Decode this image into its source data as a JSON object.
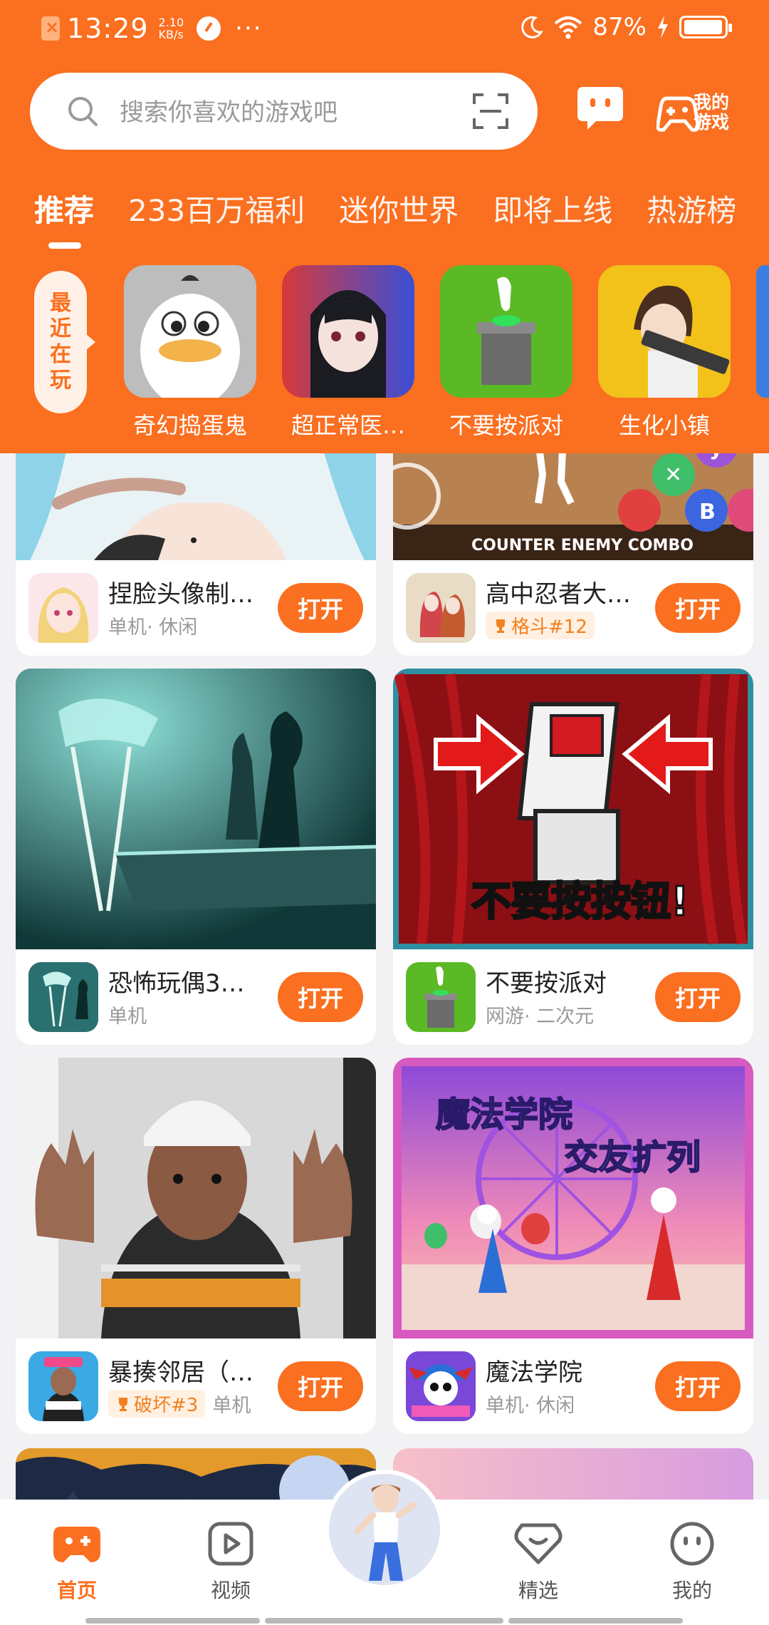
{
  "status_bar": {
    "time": "13:29",
    "speed_value": "2.10",
    "speed_unit": "KB/s",
    "more": "···",
    "battery": "87%"
  },
  "search": {
    "placeholder": "搜索你喜欢的游戏吧"
  },
  "header": {
    "my_games_label": "我的游戏"
  },
  "tabs": [
    {
      "label": "推荐",
      "active": true
    },
    {
      "label": "233百万福利",
      "active": false
    },
    {
      "label": "迷你世界",
      "active": false
    },
    {
      "label": "即将上线",
      "active": false
    },
    {
      "label": "热游榜",
      "active": false
    }
  ],
  "recent": {
    "tag_chars": [
      "最",
      "近",
      "在",
      "玩"
    ],
    "items": [
      {
        "name": "奇幻捣蛋鬼"
      },
      {
        "name": "超正常医…"
      },
      {
        "name": "不要按派对"
      },
      {
        "name": "生化小镇"
      }
    ]
  },
  "feed": {
    "open_label": "打开",
    "cards": [
      {
        "title": "捏脸头像制…",
        "tags": "单机· 休闲",
        "rank": ""
      },
      {
        "title": "高中忍者大…",
        "tags": "",
        "rank": "格斗#12",
        "image_caption": "COUNTER ENEMY COMBO"
      },
      {
        "title": "恐怖玩偶3…",
        "tags": "单机",
        "rank": ""
      },
      {
        "title": "不要按派对",
        "tags": "网游· 二次元",
        "rank": "",
        "image_caption": "不要按按钮!"
      },
      {
        "title": "暴揍邻居（…",
        "tags": "单机",
        "rank": "破坏#3"
      },
      {
        "title": "魔法学院",
        "tags": "单机· 休闲",
        "rank": "",
        "image_caption_1": "魔法学院",
        "image_caption_2": "交友扩列"
      }
    ]
  },
  "bottom_nav": [
    {
      "label": "首页",
      "active": true
    },
    {
      "label": "视频",
      "active": false
    },
    {
      "label": "精选",
      "active": false
    },
    {
      "label": "我的",
      "active": false
    }
  ],
  "colors": {
    "brand": "#fa6f20",
    "background": "#f2f2f4"
  }
}
